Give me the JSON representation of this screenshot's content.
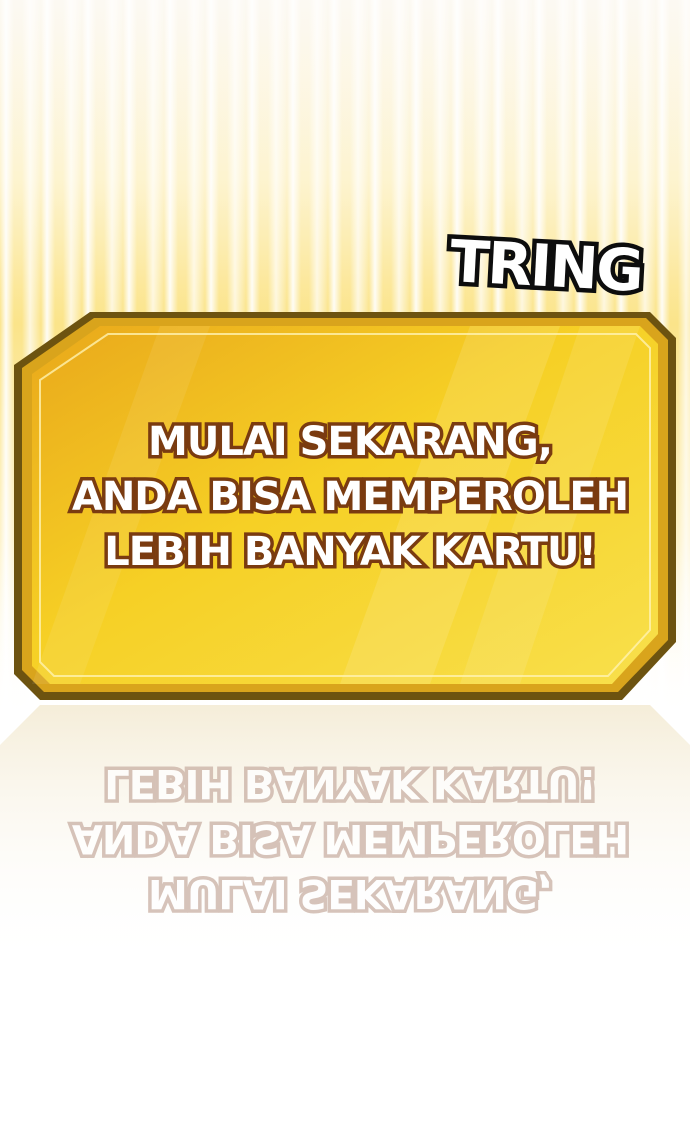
{
  "panel": {
    "sound_effect": "TRING",
    "message_lines": [
      "MULAI SEKARANG,",
      "ANDA BISA MEMPEROLEH",
      "LEBIH BANYAK KARTU!"
    ]
  },
  "colors": {
    "card_gold": "#f2c21a",
    "card_border": "#7a5a10",
    "text_outline": "#7a3b10"
  }
}
